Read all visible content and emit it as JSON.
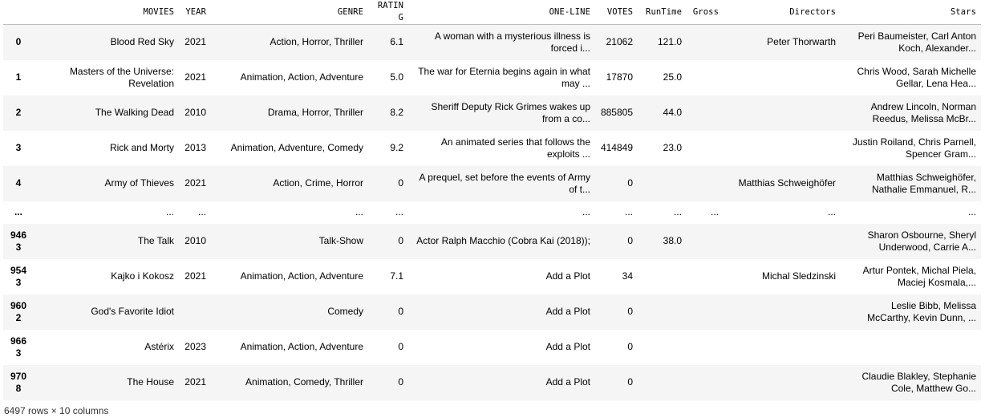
{
  "columns": [
    "",
    "MOVIES",
    "YEAR",
    "GENRE",
    "RATING",
    "ONE-LINE",
    "VOTES",
    "RunTime",
    "Gross",
    "Directors",
    "Stars"
  ],
  "rows": [
    [
      "0",
      "Blood Red Sky",
      "2021",
      "Action, Horror, Thriller",
      "6.1",
      "A woman with a mysterious illness is forced i...",
      "21062",
      "121.0",
      "",
      "Peter Thorwarth",
      "Peri Baumeister, Carl Anton Koch, Alexander..."
    ],
    [
      "1",
      "Masters of the Universe: Revelation",
      "2021",
      "Animation, Action, Adventure",
      "5.0",
      "The war for Eternia begins again in what may ...",
      "17870",
      "25.0",
      "",
      "",
      "Chris Wood, Sarah Michelle Gellar, Lena Hea..."
    ],
    [
      "2",
      "The Walking Dead",
      "2010",
      "Drama, Horror, Thriller",
      "8.2",
      "Sheriff Deputy Rick Grimes wakes up from a co...",
      "885805",
      "44.0",
      "",
      "",
      "Andrew Lincoln, Norman Reedus, Melissa McBr..."
    ],
    [
      "3",
      "Rick and Morty",
      "2013",
      "Animation, Adventure, Comedy",
      "9.2",
      "An animated series that follows the exploits ...",
      "414849",
      "23.0",
      "",
      "",
      "Justin Roiland, Chris Parnell, Spencer Gram..."
    ],
    [
      "4",
      "Army of Thieves",
      "2021",
      "Action, Crime, Horror",
      "0",
      "A prequel, set before the events of Army of t...",
      "0",
      "",
      "",
      "Matthias Schweighöfer",
      "Matthias Schweighöfer, Nathalie Emmanuel, R..."
    ],
    [
      "...",
      "...",
      "...",
      "...",
      "...",
      "...",
      "...",
      "...",
      "...",
      "...",
      "..."
    ],
    [
      "9463",
      "The Talk",
      "2010",
      "Talk-Show",
      "0",
      "Actor Ralph Macchio (Cobra Kai (2018));",
      "0",
      "38.0",
      "",
      "",
      "Sharon Osbourne, Sheryl Underwood, Carrie A..."
    ],
    [
      "9543",
      "Kajko i Kokosz",
      "2021",
      "Animation, Action, Adventure",
      "7.1",
      "Add a Plot",
      "34",
      "",
      "",
      "Michal Sledzinski",
      "Artur Pontek, Michal Piela, Maciej Kosmala,..."
    ],
    [
      "9602",
      "God's Favorite Idiot",
      "",
      "Comedy",
      "0",
      "Add a Plot",
      "0",
      "",
      "",
      "",
      "Leslie Bibb, Melissa McCarthy, Kevin Dunn, ..."
    ],
    [
      "9663",
      "Astérix",
      "2023",
      "Animation, Action, Adventure",
      "0",
      "Add a Plot",
      "0",
      "",
      "",
      "",
      ""
    ],
    [
      "9708",
      "The House",
      "2021",
      "Animation, Comedy, Thriller",
      "0",
      "Add a Plot",
      "0",
      "",
      "",
      "",
      "Claudie Blakley, Stephanie Cole, Matthew Go..."
    ]
  ],
  "footer": "6497 rows × 10 columns"
}
